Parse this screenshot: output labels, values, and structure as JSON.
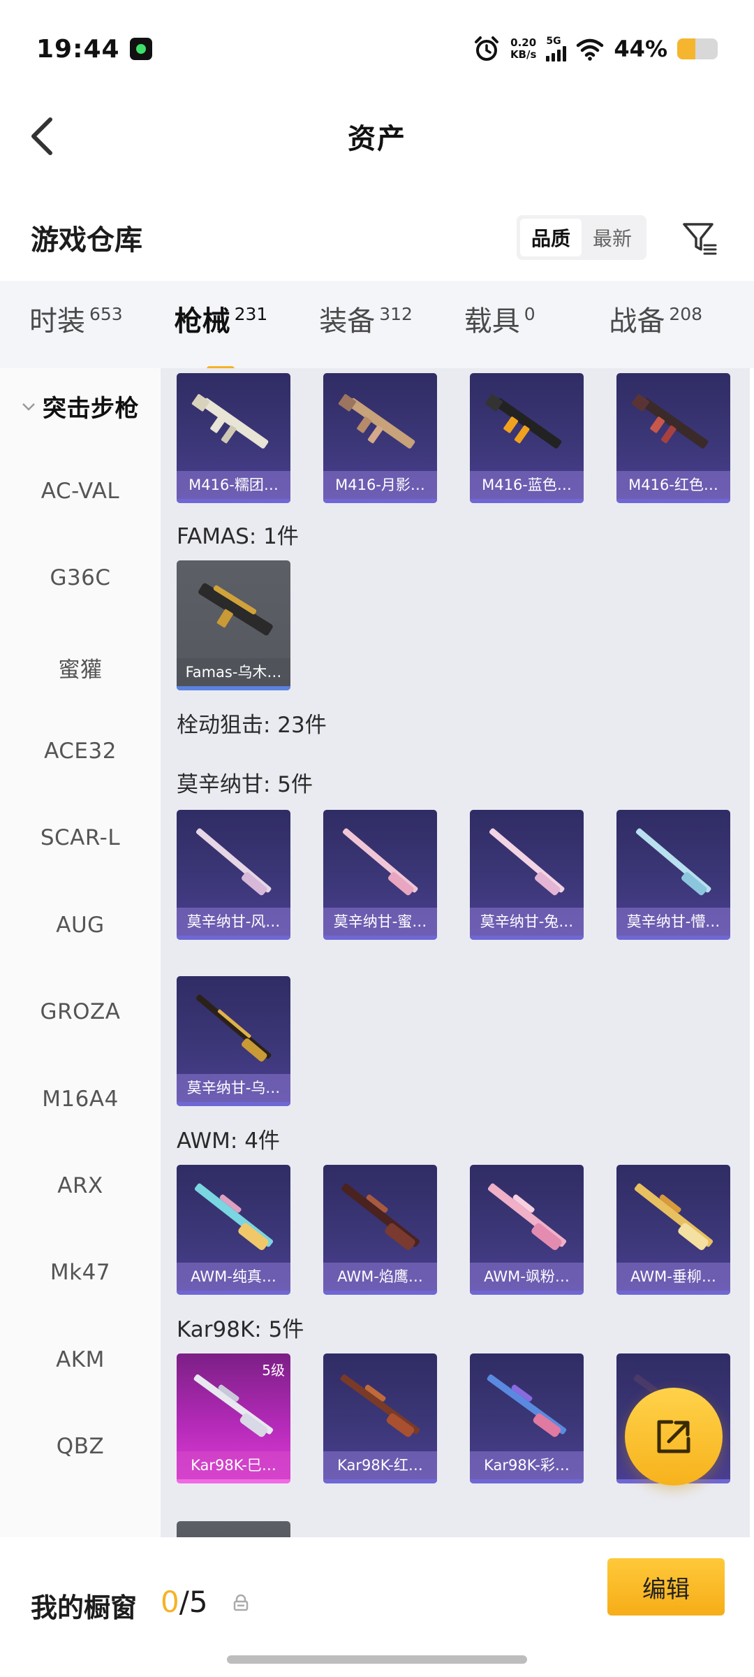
{
  "status_bar": {
    "time": "19:44",
    "net_speed_value": "0.20",
    "net_speed_unit": "KB/s",
    "signal_type": "5G",
    "battery_percent": "44%",
    "battery_level": 0.44
  },
  "header": {
    "title": "资产"
  },
  "section": {
    "title": "游戏仓库",
    "sort_options": [
      "品质",
      "最新"
    ],
    "active_sort": "品质"
  },
  "tabs": [
    {
      "label": "时装",
      "count": "653"
    },
    {
      "label": "枪械",
      "count": "231"
    },
    {
      "label": "装备",
      "count": "312"
    },
    {
      "label": "载具",
      "count": "0"
    },
    {
      "label": "战备",
      "count": "208"
    }
  ],
  "active_tab": "枪械",
  "sidebar": {
    "items": [
      "突击步枪",
      "AC-VAL",
      "G36C",
      "蜜獾",
      "ACE32",
      "SCAR-L",
      "AUG",
      "GROZA",
      "M16A4",
      "ARX",
      "Mk47",
      "AKM",
      "QBZ"
    ]
  },
  "content": {
    "m416_cards": [
      "M416-糯团…",
      "M416-月影…",
      "M416-蓝色…",
      "M416-红色…"
    ],
    "famas_label": "FAMAS: 1件",
    "famas_cards": [
      "Famas-乌木…"
    ],
    "bolt_sniper_label": "栓动狙击: 23件",
    "mosin_label": "莫辛纳甘: 5件",
    "mosin_cards": [
      "莫辛纳甘-风…",
      "莫辛纳甘-蜜…",
      "莫辛纳甘-兔…",
      "莫辛纳甘-懵…",
      "莫辛纳甘-乌…"
    ],
    "awm_label": "AWM: 4件",
    "awm_cards": [
      "AWM-纯真…",
      "AWM-焰鹰…",
      "AWM-飒粉…",
      "AWM-垂柳…"
    ],
    "kar98k_label": "Kar98K: 5件",
    "kar98k_cards": [
      "Kar98K-巳…",
      "Kar98K-红…",
      "Kar98K-彩…"
    ],
    "kar98k_first_level": "5级"
  },
  "bottom_bar": {
    "showcase_label": "我的橱窗",
    "showcase_current": "0",
    "showcase_total": "/5",
    "edit_label": "编辑"
  },
  "colors": {
    "accent": "#f5b326",
    "card_purple": "#3c3778",
    "card_pink": "#e13dd6",
    "content_bg": "#eaebf1"
  },
  "icons": [
    "back-arrow-icon",
    "filter-icon",
    "alarm-icon",
    "wifi-icon",
    "chevron-down-icon",
    "share-icon",
    "lock-icon"
  ]
}
